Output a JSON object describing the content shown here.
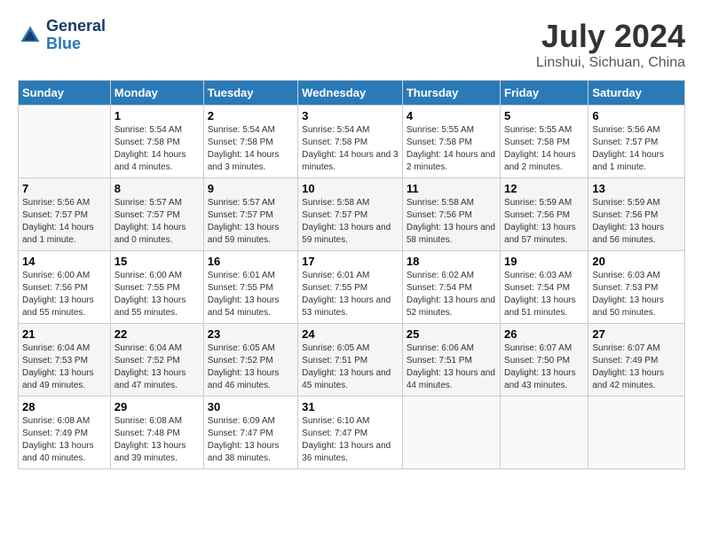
{
  "logo": {
    "line1": "General",
    "line2": "Blue"
  },
  "title": "July 2024",
  "subtitle": "Linshui, Sichuan, China",
  "days_header": [
    "Sunday",
    "Monday",
    "Tuesday",
    "Wednesday",
    "Thursday",
    "Friday",
    "Saturday"
  ],
  "weeks": [
    [
      {
        "num": "",
        "sunrise": "",
        "sunset": "",
        "daylight": ""
      },
      {
        "num": "1",
        "sunrise": "Sunrise: 5:54 AM",
        "sunset": "Sunset: 7:58 PM",
        "daylight": "Daylight: 14 hours and 4 minutes."
      },
      {
        "num": "2",
        "sunrise": "Sunrise: 5:54 AM",
        "sunset": "Sunset: 7:58 PM",
        "daylight": "Daylight: 14 hours and 3 minutes."
      },
      {
        "num": "3",
        "sunrise": "Sunrise: 5:54 AM",
        "sunset": "Sunset: 7:58 PM",
        "daylight": "Daylight: 14 hours and 3 minutes."
      },
      {
        "num": "4",
        "sunrise": "Sunrise: 5:55 AM",
        "sunset": "Sunset: 7:58 PM",
        "daylight": "Daylight: 14 hours and 2 minutes."
      },
      {
        "num": "5",
        "sunrise": "Sunrise: 5:55 AM",
        "sunset": "Sunset: 7:58 PM",
        "daylight": "Daylight: 14 hours and 2 minutes."
      },
      {
        "num": "6",
        "sunrise": "Sunrise: 5:56 AM",
        "sunset": "Sunset: 7:57 PM",
        "daylight": "Daylight: 14 hours and 1 minute."
      }
    ],
    [
      {
        "num": "7",
        "sunrise": "Sunrise: 5:56 AM",
        "sunset": "Sunset: 7:57 PM",
        "daylight": "Daylight: 14 hours and 1 minute."
      },
      {
        "num": "8",
        "sunrise": "Sunrise: 5:57 AM",
        "sunset": "Sunset: 7:57 PM",
        "daylight": "Daylight: 14 hours and 0 minutes."
      },
      {
        "num": "9",
        "sunrise": "Sunrise: 5:57 AM",
        "sunset": "Sunset: 7:57 PM",
        "daylight": "Daylight: 13 hours and 59 minutes."
      },
      {
        "num": "10",
        "sunrise": "Sunrise: 5:58 AM",
        "sunset": "Sunset: 7:57 PM",
        "daylight": "Daylight: 13 hours and 59 minutes."
      },
      {
        "num": "11",
        "sunrise": "Sunrise: 5:58 AM",
        "sunset": "Sunset: 7:56 PM",
        "daylight": "Daylight: 13 hours and 58 minutes."
      },
      {
        "num": "12",
        "sunrise": "Sunrise: 5:59 AM",
        "sunset": "Sunset: 7:56 PM",
        "daylight": "Daylight: 13 hours and 57 minutes."
      },
      {
        "num": "13",
        "sunrise": "Sunrise: 5:59 AM",
        "sunset": "Sunset: 7:56 PM",
        "daylight": "Daylight: 13 hours and 56 minutes."
      }
    ],
    [
      {
        "num": "14",
        "sunrise": "Sunrise: 6:00 AM",
        "sunset": "Sunset: 7:56 PM",
        "daylight": "Daylight: 13 hours and 55 minutes."
      },
      {
        "num": "15",
        "sunrise": "Sunrise: 6:00 AM",
        "sunset": "Sunset: 7:55 PM",
        "daylight": "Daylight: 13 hours and 55 minutes."
      },
      {
        "num": "16",
        "sunrise": "Sunrise: 6:01 AM",
        "sunset": "Sunset: 7:55 PM",
        "daylight": "Daylight: 13 hours and 54 minutes."
      },
      {
        "num": "17",
        "sunrise": "Sunrise: 6:01 AM",
        "sunset": "Sunset: 7:55 PM",
        "daylight": "Daylight: 13 hours and 53 minutes."
      },
      {
        "num": "18",
        "sunrise": "Sunrise: 6:02 AM",
        "sunset": "Sunset: 7:54 PM",
        "daylight": "Daylight: 13 hours and 52 minutes."
      },
      {
        "num": "19",
        "sunrise": "Sunrise: 6:03 AM",
        "sunset": "Sunset: 7:54 PM",
        "daylight": "Daylight: 13 hours and 51 minutes."
      },
      {
        "num": "20",
        "sunrise": "Sunrise: 6:03 AM",
        "sunset": "Sunset: 7:53 PM",
        "daylight": "Daylight: 13 hours and 50 minutes."
      }
    ],
    [
      {
        "num": "21",
        "sunrise": "Sunrise: 6:04 AM",
        "sunset": "Sunset: 7:53 PM",
        "daylight": "Daylight: 13 hours and 49 minutes."
      },
      {
        "num": "22",
        "sunrise": "Sunrise: 6:04 AM",
        "sunset": "Sunset: 7:52 PM",
        "daylight": "Daylight: 13 hours and 47 minutes."
      },
      {
        "num": "23",
        "sunrise": "Sunrise: 6:05 AM",
        "sunset": "Sunset: 7:52 PM",
        "daylight": "Daylight: 13 hours and 46 minutes."
      },
      {
        "num": "24",
        "sunrise": "Sunrise: 6:05 AM",
        "sunset": "Sunset: 7:51 PM",
        "daylight": "Daylight: 13 hours and 45 minutes."
      },
      {
        "num": "25",
        "sunrise": "Sunrise: 6:06 AM",
        "sunset": "Sunset: 7:51 PM",
        "daylight": "Daylight: 13 hours and 44 minutes."
      },
      {
        "num": "26",
        "sunrise": "Sunrise: 6:07 AM",
        "sunset": "Sunset: 7:50 PM",
        "daylight": "Daylight: 13 hours and 43 minutes."
      },
      {
        "num": "27",
        "sunrise": "Sunrise: 6:07 AM",
        "sunset": "Sunset: 7:49 PM",
        "daylight": "Daylight: 13 hours and 42 minutes."
      }
    ],
    [
      {
        "num": "28",
        "sunrise": "Sunrise: 6:08 AM",
        "sunset": "Sunset: 7:49 PM",
        "daylight": "Daylight: 13 hours and 40 minutes."
      },
      {
        "num": "29",
        "sunrise": "Sunrise: 6:08 AM",
        "sunset": "Sunset: 7:48 PM",
        "daylight": "Daylight: 13 hours and 39 minutes."
      },
      {
        "num": "30",
        "sunrise": "Sunrise: 6:09 AM",
        "sunset": "Sunset: 7:47 PM",
        "daylight": "Daylight: 13 hours and 38 minutes."
      },
      {
        "num": "31",
        "sunrise": "Sunrise: 6:10 AM",
        "sunset": "Sunset: 7:47 PM",
        "daylight": "Daylight: 13 hours and 36 minutes."
      },
      {
        "num": "",
        "sunrise": "",
        "sunset": "",
        "daylight": ""
      },
      {
        "num": "",
        "sunrise": "",
        "sunset": "",
        "daylight": ""
      },
      {
        "num": "",
        "sunrise": "",
        "sunset": "",
        "daylight": ""
      }
    ]
  ]
}
